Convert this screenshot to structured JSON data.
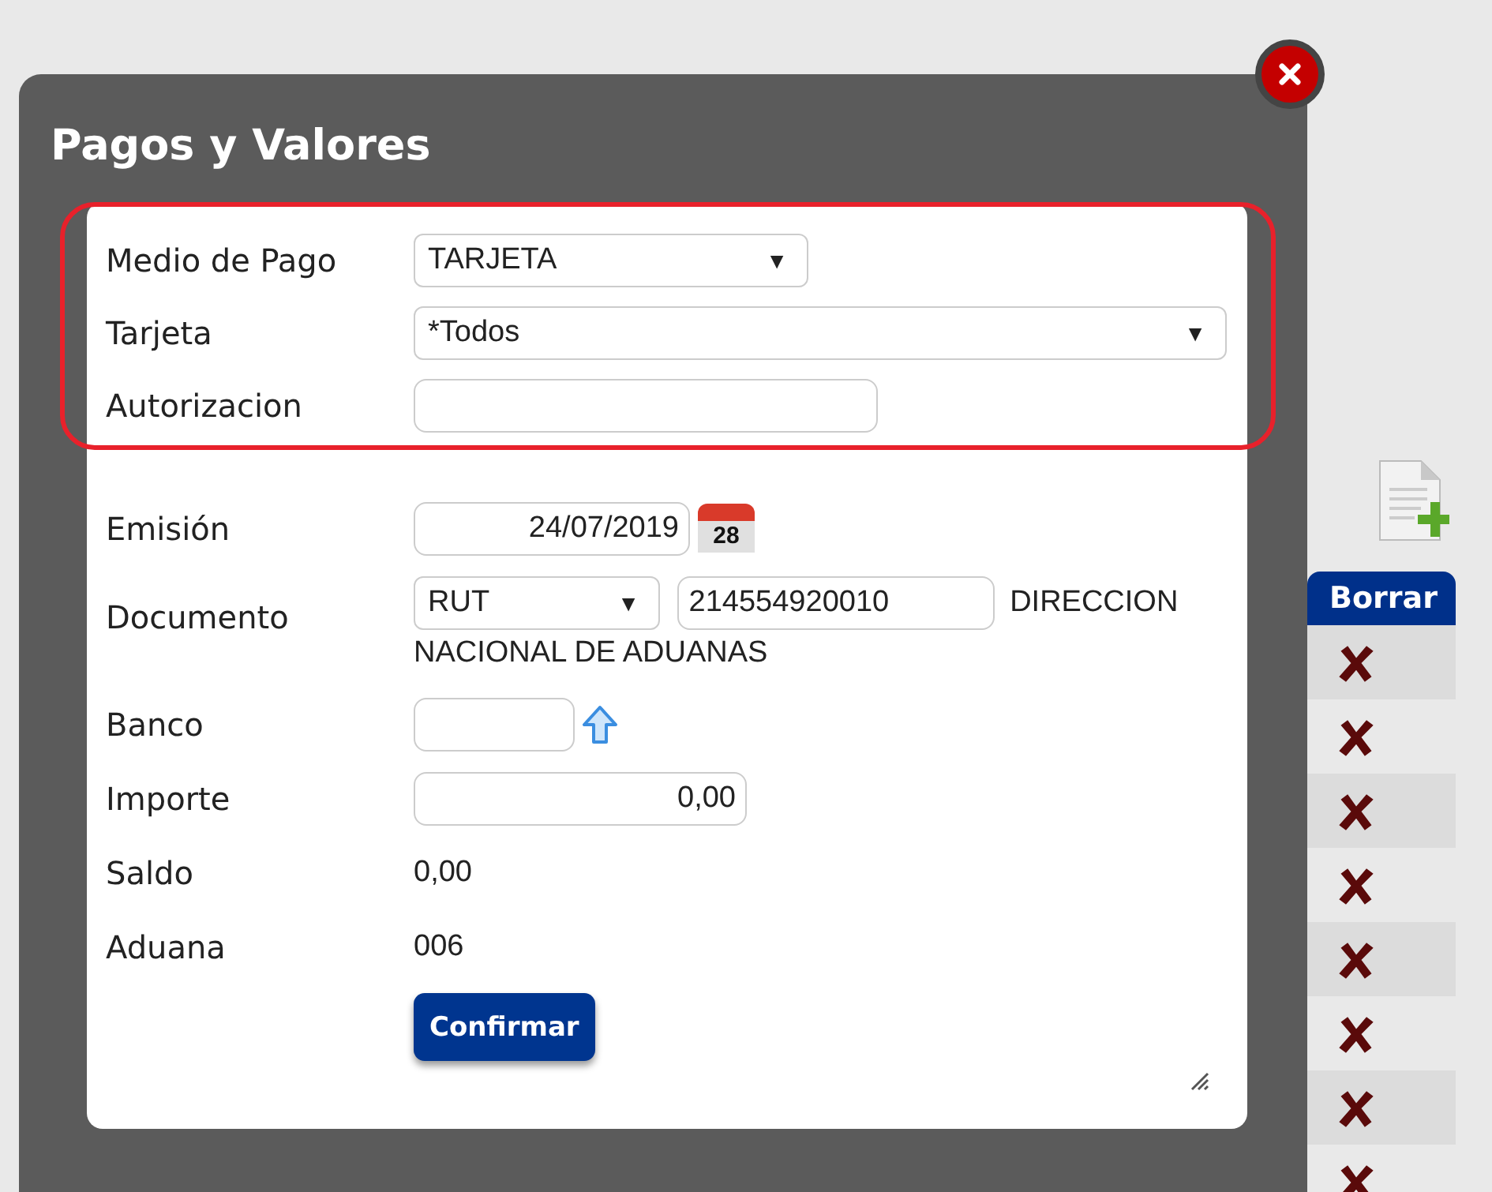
{
  "dialog": {
    "title": "Pagos y Valores"
  },
  "highlighted_fields": [
    {
      "kind": "select",
      "label": "Medio de Pago",
      "value": "TARJETA",
      "wide": false,
      "arrow": "▼"
    },
    {
      "kind": "select",
      "label": "Tarjeta",
      "value": "*Todos",
      "wide": true,
      "arrow": "▼"
    },
    {
      "kind": "text",
      "label": "Autorizacion"
    }
  ],
  "fields": [
    {
      "kind": "date",
      "label": "Emisión",
      "value": "24/07/2019",
      "calendar_day": "28"
    },
    {
      "kind": "document",
      "label": "Documento",
      "doc_type": "RUT",
      "arrow": "▼",
      "number": "214554920010",
      "name_lines": [
        "DIRECCION",
        "NACIONAL DE ADUANAS"
      ]
    },
    {
      "kind": "lookup",
      "label": "Banco"
    },
    {
      "kind": "amount",
      "label": "Importe",
      "value": "0,00"
    },
    {
      "kind": "readout",
      "label": "Saldo",
      "value": "0,00"
    },
    {
      "kind": "readout",
      "label": "Aduana",
      "value": "006"
    }
  ],
  "confirm_button": "Confirmar",
  "background_table": {
    "columns": [
      "Borrar"
    ],
    "rows": [
      {
        "kind": "delete"
      },
      {
        "kind": "delete"
      },
      {
        "kind": "delete"
      },
      {
        "kind": "delete"
      },
      {
        "kind": "delete"
      },
      {
        "kind": "delete"
      },
      {
        "kind": "delete"
      },
      {
        "kind": "delete"
      }
    ]
  }
}
